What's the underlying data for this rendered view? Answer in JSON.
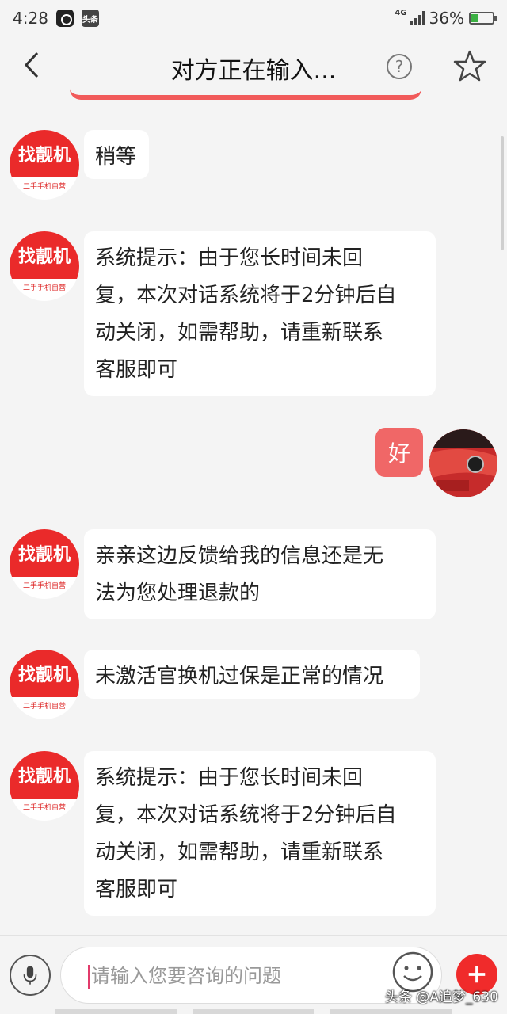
{
  "status_bar": {
    "time": "4:28",
    "network": "4G",
    "battery": "36%",
    "battery_level": 0.36,
    "news_app_label": "头条"
  },
  "header": {
    "title": "对方正在输入...",
    "help_symbol": "?"
  },
  "bot": {
    "avatar_main": "找靓机",
    "avatar_sub": "二手手机自营"
  },
  "messages": [
    {
      "from": "bot",
      "text": "稍等"
    },
    {
      "from": "bot",
      "lines": [
        "系统提示：由于您长时间未回",
        "复，本次对话系统将于2分钟后自",
        "动关闭，如需帮助，请重新联系",
        "客服即可"
      ]
    },
    {
      "from": "user",
      "text": "好"
    },
    {
      "from": "bot",
      "lines": [
        "亲亲这边反馈给我的信息还是无",
        "法为您处理退款的"
      ]
    },
    {
      "from": "bot",
      "text": "未激活官换机过保是正常的情况"
    },
    {
      "from": "bot",
      "lines": [
        "系统提示：由于您长时间未回",
        "复，本次对话系统将于2分钟后自",
        "动关闭，如需帮助，请重新联系",
        "客服即可"
      ]
    }
  ],
  "input": {
    "placeholder": "请输入您要咨询的问题",
    "value": ""
  },
  "watermark": "头条 @A追梦_630",
  "colors": {
    "accent": "#f02b2b",
    "user_bubble": "#f06767",
    "background": "#f4f4f4"
  }
}
